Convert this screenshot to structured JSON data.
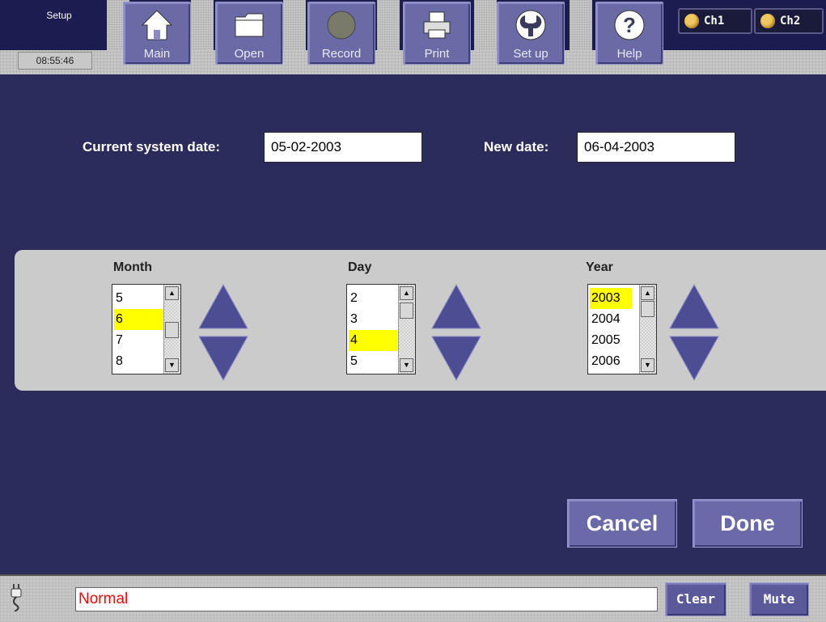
{
  "toolbar": {
    "mode_label": "Setup",
    "clock": "08:55:46",
    "buttons": [
      {
        "label": "Main",
        "icon": "home-icon"
      },
      {
        "label": "Open",
        "icon": "folder-icon"
      },
      {
        "label": "Record",
        "icon": "record-icon"
      },
      {
        "label": "Print",
        "icon": "printer-icon"
      },
      {
        "label": "Set up",
        "icon": "wrench-icon"
      },
      {
        "label": "Help",
        "icon": "help-icon"
      }
    ],
    "channels": [
      "Ch1",
      "Ch2"
    ]
  },
  "date": {
    "current_label": "Current system date:",
    "current_value": "05-02-2003",
    "new_label": "New date:",
    "new_value": "06-04-2003"
  },
  "pickers": {
    "month": {
      "label": "Month",
      "items": [
        "5",
        "6",
        "7",
        "8"
      ],
      "selected": "6"
    },
    "day": {
      "label": "Day",
      "items": [
        "2",
        "3",
        "4",
        "5"
      ],
      "selected": "4"
    },
    "year": {
      "label": "Year",
      "items": [
        "2003",
        "2004",
        "2005",
        "2006"
      ],
      "selected": "2003"
    }
  },
  "actions": {
    "cancel": "Cancel",
    "done": "Done"
  },
  "status": {
    "text": "Normal",
    "clear": "Clear",
    "mute": "Mute"
  },
  "colors": {
    "background": "#2c2c5c",
    "button": "#6a6aa8",
    "selection": "#ffff00",
    "status_text": "#ff0000"
  }
}
